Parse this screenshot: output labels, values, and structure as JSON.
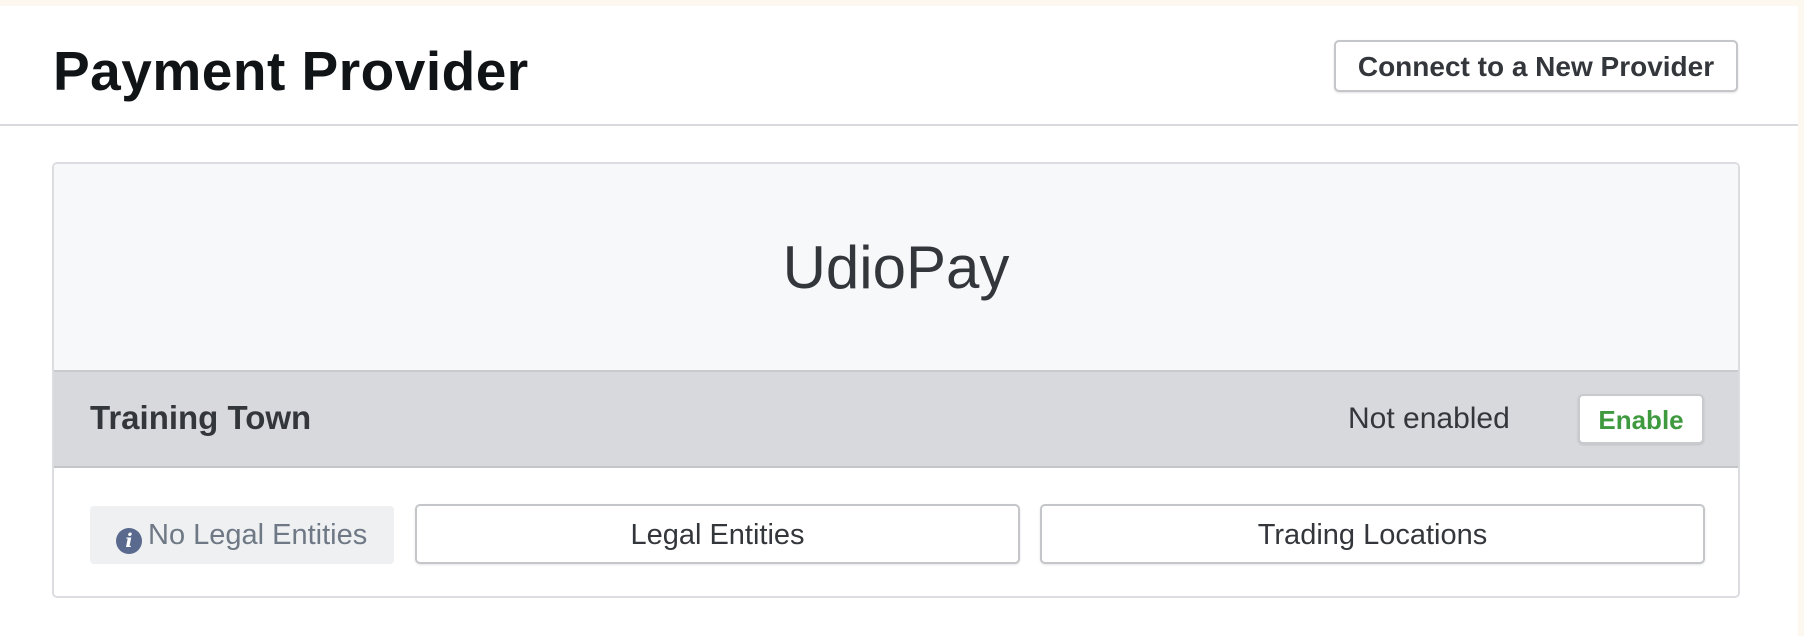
{
  "header": {
    "title": "Payment Provider",
    "connect_button_label": "Connect to a New Provider"
  },
  "provider": {
    "name": "UdioPay",
    "entity": {
      "name": "Training Town",
      "status": "Not enabled",
      "enable_button_label": "Enable"
    },
    "actions": {
      "no_entities_label": "No Legal Entities",
      "info_icon": "info-circle-icon",
      "legal_entities_label": "Legal Entities",
      "trading_locations_label": "Trading Locations"
    }
  },
  "colors": {
    "accent_green": "#3f9a3f",
    "banner_background": "#f7f8fa",
    "entity_row_background": "#d8d9dd",
    "info_icon": "#5a6a8e"
  }
}
